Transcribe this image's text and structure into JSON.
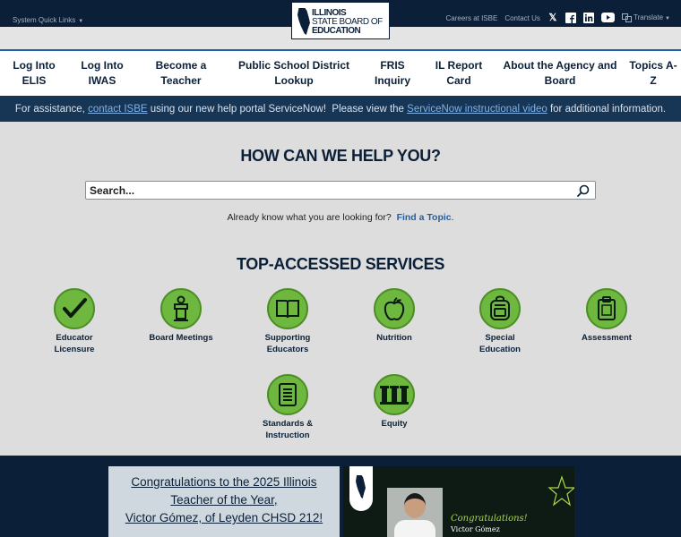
{
  "topbar": {
    "quick_links": "System Quick Links",
    "careers": "Careers at ISBE",
    "contact": "Contact Us",
    "translate": "Translate",
    "icons": [
      "x-icon",
      "facebook-icon",
      "linkedin-icon",
      "youtube-icon"
    ]
  },
  "logo": {
    "line1": "ILLINOIS",
    "line2": "STATE BOARD OF",
    "line3": "EDUCATION"
  },
  "nav": [
    {
      "line1": "Log Into",
      "line2": "ELIS"
    },
    {
      "line1": "Log Into",
      "line2": "IWAS"
    },
    {
      "line1": "Become a",
      "line2": "Teacher"
    },
    {
      "line1": "Public School District",
      "line2": "Lookup"
    },
    {
      "line1": "FRIS",
      "line2": "Inquiry"
    },
    {
      "line1": "IL Report",
      "line2": "Card"
    },
    {
      "line1": "About the Agency and",
      "line2": "Board"
    },
    {
      "line1": "Topics A-",
      "line2": "Z"
    }
  ],
  "assist": {
    "t1": "For assistance, ",
    "link1": "contact ISBE",
    "t2": " using our new help portal ServiceNow!  Please view the ",
    "link2": "ServiceNow instructional video",
    "t3": " for additional information."
  },
  "help": {
    "title": "HOW CAN WE HELP YOU?",
    "search_placeholder": "Search...",
    "already": "Already know what you are looking for?",
    "topic_link": "Find a Topic",
    "period": "."
  },
  "services": {
    "title": "TOP-ACCESSED SERVICES",
    "items": [
      {
        "line1": "Educator",
        "line2": "Licensure",
        "icon": "checkmark-icon"
      },
      {
        "line1": "Board Meetings",
        "line2": "",
        "icon": "podium-speaker-icon"
      },
      {
        "line1": "Supporting",
        "line2": "Educators",
        "icon": "open-book-icon"
      },
      {
        "line1": "Nutrition",
        "line2": "",
        "icon": "apple-icon"
      },
      {
        "line1": "Special",
        "line2": "Education",
        "icon": "backpack-icon"
      },
      {
        "line1": "Assessment",
        "line2": "",
        "icon": "clipboard-icon"
      },
      {
        "line1": "Standards &",
        "line2": "Instruction",
        "icon": "document-list-icon"
      },
      {
        "line1": "Equity",
        "line2": "",
        "icon": "balanced-pillars-icon"
      }
    ]
  },
  "promo": {
    "line1": "Congratulations to the 2025 Illinois",
    "line2": "Teacher of the Year,",
    "line3": "Victor Gómez, of Leyden CHSD 212!",
    "banner_msg": "Congratulations!",
    "banner_name": "Victor Gómez"
  },
  "colors": {
    "navy": "#0b2038",
    "accent_green": "#6fb83f",
    "link_blue": "#1f5fa8"
  }
}
